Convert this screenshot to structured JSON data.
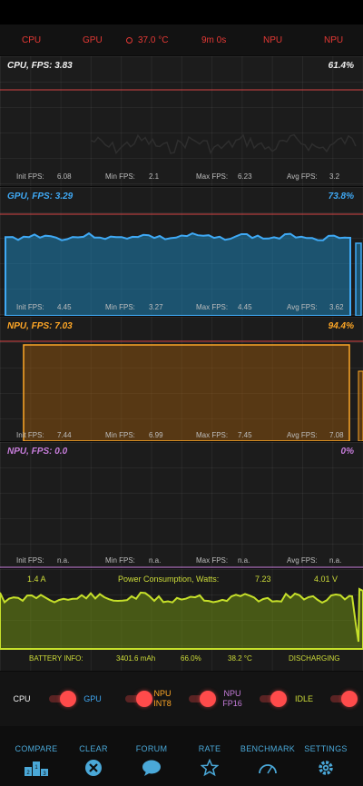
{
  "topbar": {
    "cpu": "CPU",
    "gpu": "GPU",
    "temperature": "37.0 °C",
    "elapsed": "9m 0s",
    "npu1": "NPU",
    "npu2": "NPU"
  },
  "panels": {
    "cpu": {
      "title": "CPU, FPS:  3.83",
      "percent": "61.4%",
      "color": "#f2f2f2",
      "stats": {
        "init_label": "Init FPS:",
        "init": "6.08",
        "min_label": "Min FPS:",
        "min": "2.1",
        "max_label": "Max FPS:",
        "max": "6.23",
        "avg_label": "Avg FPS:",
        "avg": "3.2"
      }
    },
    "gpu": {
      "title": "GPU, FPS:  3.29",
      "percent": "73.8%",
      "color": "#3fa9f5",
      "stats": {
        "init_label": "Init FPS:",
        "init": "4.45",
        "min_label": "Min FPS:",
        "min": "3.27",
        "max_label": "Max FPS:",
        "max": "4.45",
        "avg_label": "Avg FPS:",
        "avg": "3.62"
      }
    },
    "npu8": {
      "title": "NPU, FPS:  7.03",
      "percent": "94.4%",
      "color": "#ffa726",
      "stats": {
        "init_label": "Init FPS:",
        "init": "7.44",
        "min_label": "Min FPS:",
        "min": "6.99",
        "max_label": "Max FPS:",
        "max": "7.45",
        "avg_label": "Avg FPS:",
        "avg": "7.08"
      }
    },
    "npu16": {
      "title": "NPU, FPS:  0.0",
      "percent": "0%",
      "color": "#c77ddb",
      "stats": {
        "init_label": "Init FPS:",
        "init": "n.a.",
        "min_label": "Min FPS:",
        "min": "n.a.",
        "max_label": "Max FPS:",
        "max": "n.a.",
        "avg_label": "Avg FPS:",
        "avg": "n.a."
      }
    }
  },
  "power": {
    "current": "1.4 A",
    "label": "Power Consumption, Watts:",
    "watts": "7.23",
    "voltage": "4.01 V",
    "battery_label": "BATTERY INFO:",
    "capacity": "3401.6 mAh",
    "level": "66.0%",
    "temperature": "38.2 °C",
    "state": "DISCHARGING",
    "color": "#cddc39"
  },
  "toggles": {
    "cpu": "CPU",
    "gpu": "GPU",
    "npu_int8_line1": "NPU",
    "npu_int8_line2": "INT8",
    "npu_fp16_line1": "NPU",
    "npu_fp16_line2": "FP16",
    "idle": "IDLE"
  },
  "nav": {
    "compare": "COMPARE",
    "clear": "CLEAR",
    "forum": "FORUM",
    "rate": "RATE",
    "benchmark": "BENCHMARK",
    "settings": "SETTINGS"
  },
  "icons": {
    "temperature": "thermometer-icon",
    "compare": "podium-icon",
    "clear": "close-circle-icon",
    "forum": "chat-bubble-icon",
    "rate": "star-icon",
    "benchmark": "speedometer-icon",
    "settings": "gear-icon"
  }
}
